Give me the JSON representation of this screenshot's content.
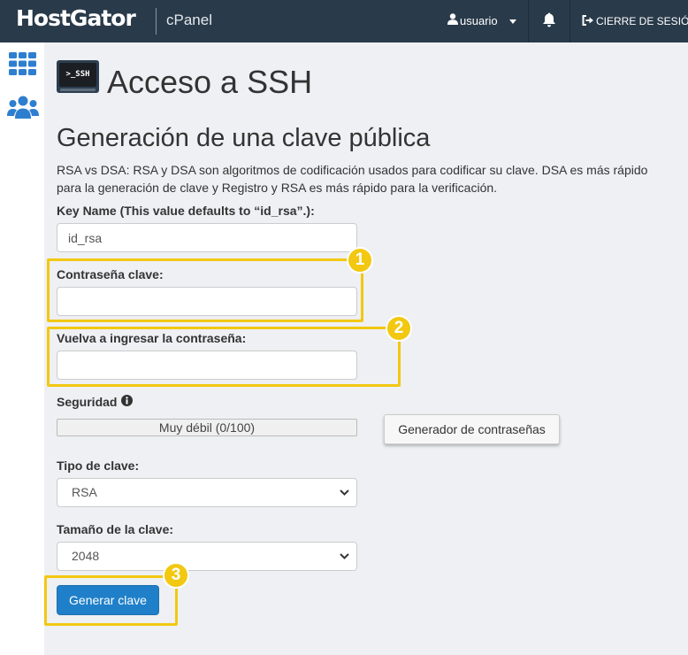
{
  "header": {
    "brand": "HostGator",
    "product": "cPanel",
    "user_label": "usuario",
    "logout_label": "CIERRE DE SESIÓN"
  },
  "sidebar": {
    "items": [
      {
        "icon": "grid-icon"
      },
      {
        "icon": "users-icon"
      }
    ]
  },
  "page": {
    "title": "Acceso a SSH",
    "icon_text": ">_SSH"
  },
  "form": {
    "section_title": "Generación de una clave pública",
    "description": "RSA vs DSA: RSA y DSA son algoritmos de codificación usados para codificar su clave. DSA es más rápido para la generación de clave y Registro y RSA es más rápido para la verificación.",
    "key_name_label": "Key Name (This value defaults to “id_rsa”.):",
    "key_name_value": "id_rsa",
    "password_label": "Contraseña clave:",
    "password_value": "",
    "password_confirm_label": "Vuelva a ingresar la contraseña:",
    "password_confirm_value": "",
    "security_label": "Seguridad",
    "strength_text": "Muy débil (0/100)",
    "strength_value": 0,
    "generator_button": "Generador de contraseñas",
    "key_type_label": "Tipo de clave:",
    "key_type_value": "RSA",
    "key_size_label": "Tamaño de la clave:",
    "key_size_value": "2048",
    "submit_button": "Generar clave"
  },
  "annotations": {
    "badge_1": "1",
    "badge_2": "2",
    "badge_3": "3",
    "highlight_color": "#f2c811"
  },
  "colors": {
    "topbar": "#293a4a",
    "primary": "#1f80c9",
    "background": "#eef0f3"
  }
}
